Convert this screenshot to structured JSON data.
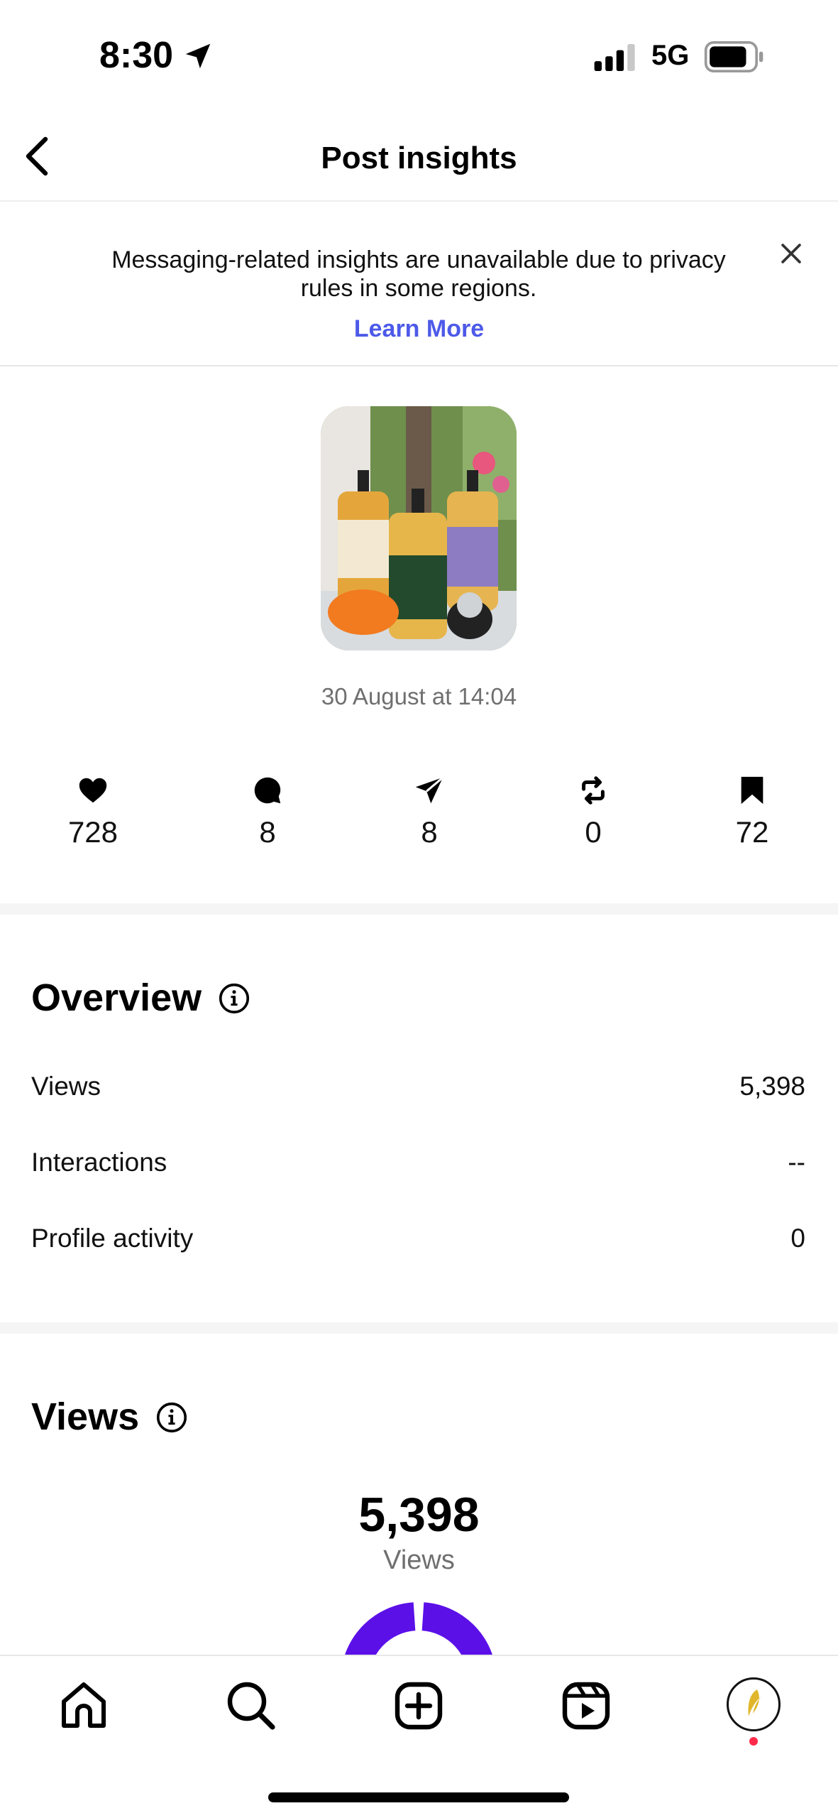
{
  "status_bar": {
    "time": "8:30",
    "network": "5G",
    "location_icon": "location-arrow-icon",
    "signal_icon": "signal-bars-icon",
    "battery_icon": "battery-icon"
  },
  "header": {
    "title": "Post insights",
    "back_icon": "chevron-left-icon"
  },
  "banner": {
    "message": "Messaging-related insights are unavailable due to privacy rules in some regions.",
    "link": "Learn More",
    "close_icon": "close-icon",
    "link_color": "#4d5ae8"
  },
  "post": {
    "date": "30 August at 14:04",
    "thumbnail_icon": "post-thumbnail"
  },
  "stats": [
    {
      "icon": "heart-icon",
      "value": "728"
    },
    {
      "icon": "comment-icon",
      "value": "8"
    },
    {
      "icon": "share-icon",
      "value": "8"
    },
    {
      "icon": "repost-icon",
      "value": "0"
    },
    {
      "icon": "bookmark-icon",
      "value": "72"
    }
  ],
  "overview": {
    "title": "Overview",
    "rows": [
      {
        "label": "Views",
        "value": "5,398"
      },
      {
        "label": "Interactions",
        "value": "--"
      },
      {
        "label": "Profile activity",
        "value": "0"
      }
    ]
  },
  "views": {
    "title": "Views",
    "total": "5,398",
    "caption": "Views",
    "donut_color": "#5b10e8"
  },
  "nav": {
    "items": [
      "home-icon",
      "search-icon",
      "create-icon",
      "reels-icon",
      "profile-avatar"
    ]
  }
}
